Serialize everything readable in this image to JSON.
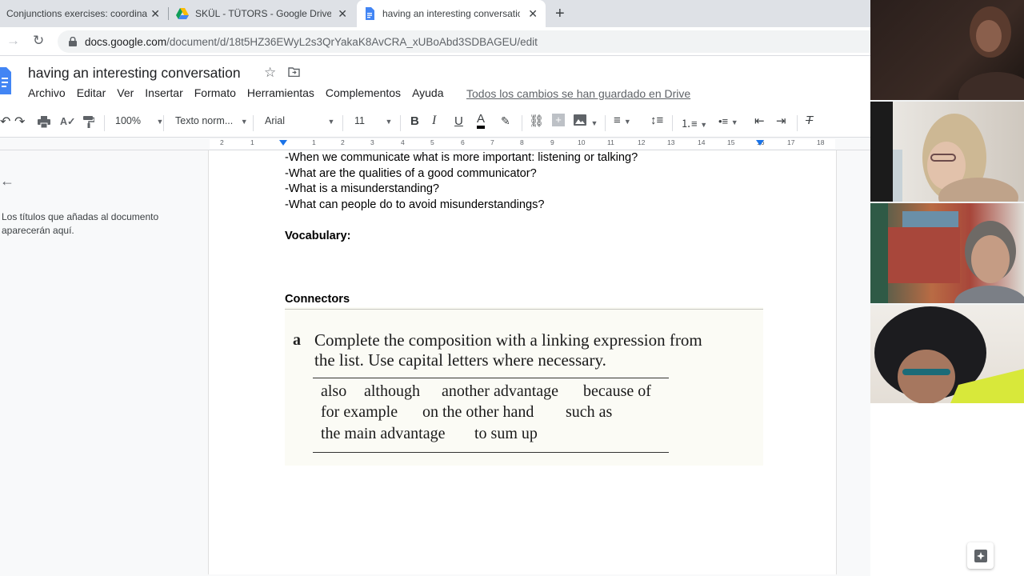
{
  "browser": {
    "tabs": [
      {
        "title": "Conjunctions exercises: coordina",
        "active": false
      },
      {
        "title": "SKÜL - TÜTORS - Google Drive",
        "active": false
      },
      {
        "title": "having an interesting conversatio",
        "active": true
      }
    ],
    "url_domain": "docs.google.com",
    "url_path": "/document/d/18t5HZ36EWyL2s3QrYakaK8AvCRA_xUBoAbd3SDBAGEU/edit"
  },
  "doc": {
    "title": "having an interesting conversation",
    "menu": [
      "Archivo",
      "Editar",
      "Ver",
      "Insertar",
      "Formato",
      "Herramientas",
      "Complementos",
      "Ayuda"
    ],
    "saved_status": "Todos los cambios se han guardado en Drive"
  },
  "toolbar": {
    "zoom": "100%",
    "style": "Texto norm...",
    "font": "Arial",
    "size": "11"
  },
  "ruler": {
    "ticks": [
      "2",
      "1",
      "1",
      "2",
      "3",
      "4",
      "5",
      "6",
      "7",
      "8",
      "9",
      "10",
      "11",
      "12",
      "13",
      "14",
      "15",
      "16",
      "17",
      "18"
    ]
  },
  "outline": {
    "empty_text": "Los títulos que añadas al documento aparecerán aquí."
  },
  "content": {
    "q1": "-When we communicate what is more important: listening or talking?",
    "q2": "-What are the qualities of a good communicator?",
    "q3": "-What is a misunderstanding?",
    "q4": "-What can people do to avoid misunderstandings?",
    "vocab_heading": "Vocabulary:",
    "connectors_heading": "Connectors",
    "exercise": {
      "letter": "a",
      "line1": "Complete the composition with a linking expression from",
      "line2": "the list. Use capital letters where necessary.",
      "words": [
        "also",
        "although",
        "another advantage",
        "because of",
        "for example",
        "on the other hand",
        "such as",
        "the main advantage",
        "to sum up"
      ]
    }
  }
}
